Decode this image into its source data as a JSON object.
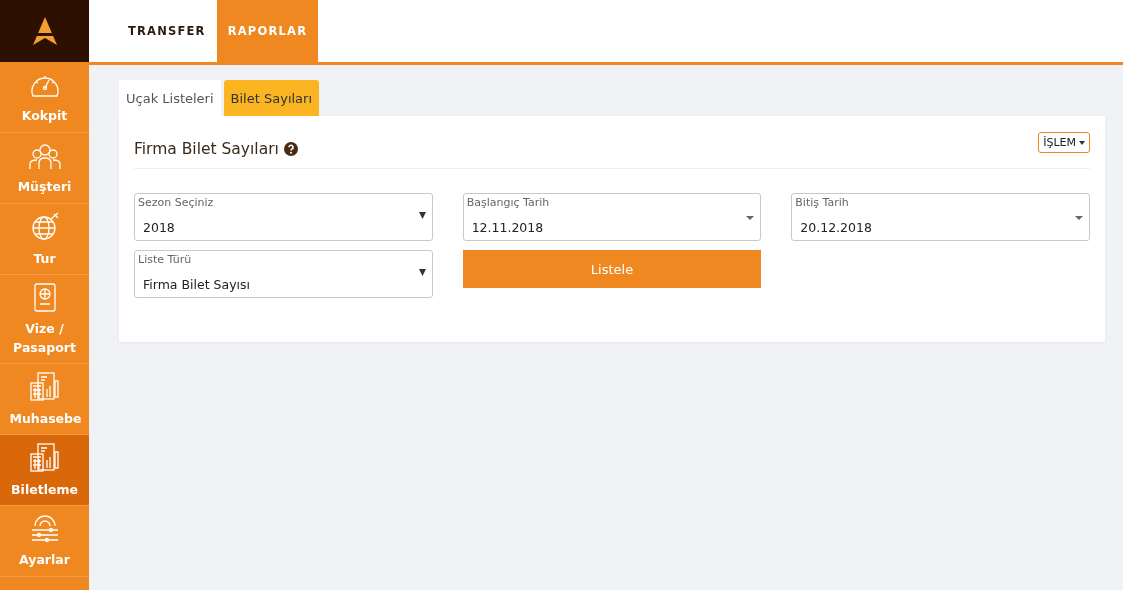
{
  "sidebar": {
    "items": [
      {
        "label": "Kokpit",
        "selected": false
      },
      {
        "label": "Müşteri",
        "selected": false
      },
      {
        "label": "Tur",
        "selected": false
      },
      {
        "label": "Vize / Pasaport",
        "selected": false
      },
      {
        "label": "Muhasebe",
        "selected": false
      },
      {
        "label": "Biletleme",
        "selected": true
      },
      {
        "label": "Ayarlar",
        "selected": false
      }
    ]
  },
  "top_nav": {
    "items": [
      {
        "label": "TRANSFER",
        "selected": false
      },
      {
        "label": "RAPORLAR",
        "selected": true
      }
    ]
  },
  "tabs": [
    {
      "label": "Uçak Listeleri",
      "selected": false
    },
    {
      "label": "Bilet Sayıları",
      "selected": true
    }
  ],
  "card": {
    "title": "Firma Bilet Sayıları",
    "action_button": "İŞLEM",
    "fields": [
      {
        "kind": "select",
        "label": "Sezon Seçiniz",
        "value": "2018"
      },
      {
        "kind": "date",
        "label": "Başlangıç Tarih",
        "value": "12.11.2018"
      },
      {
        "kind": "date",
        "label": "Bitiş Tarih",
        "value": "20.12.2018"
      },
      {
        "kind": "select",
        "label": "Liste Türü",
        "value": "Firma Bilet Sayısı"
      }
    ],
    "submit_button": "Listele"
  }
}
